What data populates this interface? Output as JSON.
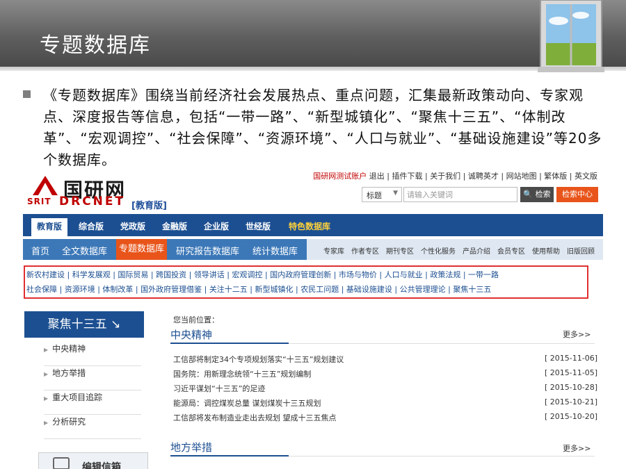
{
  "slide": {
    "title": "专题数据库",
    "bullet": "《专题数据库》围绕当前经济社会发展热点、重点问题，汇集最新政策动向、专家观点、深度报告等信息，包括“一带一路”、“新型城镇化”、“聚焦十三五”、“体制改革”、“宏观调控”、“社会保障”、“资源环境”、“人口与就业”、“基础设施建设”等20多个数据库。"
  },
  "site": {
    "topbar": {
      "account": "国研网测试账户",
      "links": [
        "退出",
        "插件下载",
        "关于我们",
        "诚聘英才",
        "网站地图",
        "繁体版",
        "英文版"
      ]
    },
    "logo": {
      "cn": "国研网",
      "en_left": "SRIT",
      "en_right": "DRCNET",
      "edition": "[教育版]"
    },
    "search": {
      "type": "标题",
      "placeholder": "请输入关键词",
      "search_btn": "检索",
      "center_btn": "检索中心"
    },
    "nav1": [
      "教育版",
      "综合版",
      "党政版",
      "金融版",
      "企业版",
      "世经版",
      "特色数据库"
    ],
    "nav2": {
      "main": [
        "首页",
        "全文数据库",
        "专题数据库",
        "研究报告数据库",
        "统计数据库"
      ],
      "side": [
        "专家库",
        "作者专区",
        "期刊专区",
        "个性化服务",
        "产品介绍",
        "会员专区",
        "使用帮助",
        "旧版回顾"
      ]
    },
    "categories": {
      "row1": [
        "新农村建设",
        "科学发展观",
        "国际贸易",
        "跨国投资",
        "领导讲话",
        "宏观调控",
        "国内政府管理创新",
        "市场与物价",
        "人口与就业",
        "政策法规",
        "一带一路"
      ],
      "row2": [
        "社会保障",
        "资源环境",
        "体制改革",
        "国外政府管理借鉴",
        "关注十二五",
        "新型城镇化",
        "农民工问题",
        "基础设施建设",
        "公共管理理论",
        "聚焦十三五"
      ]
    },
    "sidebar": {
      "title": "聚焦十三五 ↘",
      "items": [
        "中央精神",
        "地方举措",
        "重大项目追踪",
        "分析研究"
      ],
      "box_label": "编辑信箱"
    },
    "main": {
      "crumb": "您当前位置：",
      "section1": {
        "title": "中央精神",
        "more": "更多>>",
        "news": [
          {
            "t": "工信部将制定34个专项规划落实“十三五”规划建议",
            "d": "[ 2015-11-06]"
          },
          {
            "t": "国务院：用新理念统领“十三五”规划编制",
            "d": "[ 2015-11-05]"
          },
          {
            "t": "习近平谋划“十三五”的足迹",
            "d": "[ 2015-10-28]"
          },
          {
            "t": "能源局：调控煤炭总量 谋划煤炭十三五规划",
            "d": "[ 2015-10-21]"
          },
          {
            "t": "工信部将发布制造业走出去规划 望成十三五焦点",
            "d": "[ 2015-10-20]"
          }
        ]
      },
      "section2": {
        "title": "地方举措",
        "more": "更多>>"
      }
    }
  }
}
